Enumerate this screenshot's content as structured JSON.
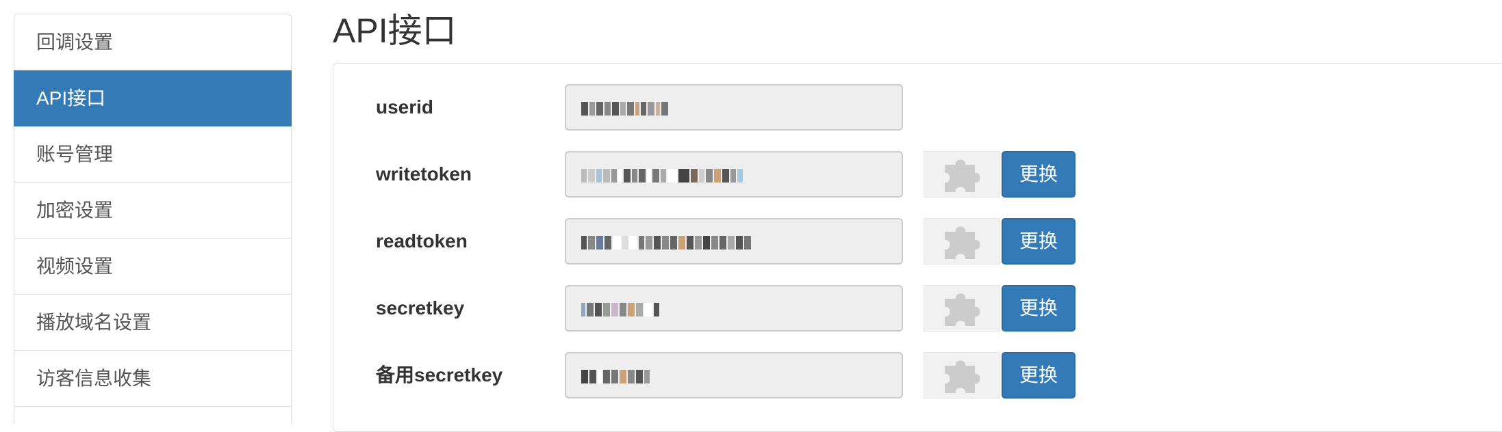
{
  "sidebar": {
    "items": [
      {
        "label": "回调设置",
        "active": false
      },
      {
        "label": "API接口",
        "active": true
      },
      {
        "label": "账号管理",
        "active": false
      },
      {
        "label": "加密设置",
        "active": false
      },
      {
        "label": "视频设置",
        "active": false
      },
      {
        "label": "播放域名设置",
        "active": false
      },
      {
        "label": "访客信息收集",
        "active": false
      }
    ]
  },
  "page": {
    "title": "API接口"
  },
  "fields": [
    {
      "label": "userid",
      "value_state": "masked",
      "has_change_button": false
    },
    {
      "label": "writetoken",
      "value_state": "masked",
      "has_change_button": true
    },
    {
      "label": "readtoken",
      "value_state": "masked",
      "has_change_button": true
    },
    {
      "label": "secretkey",
      "value_state": "masked",
      "has_change_button": true
    },
    {
      "label": "备用secretkey",
      "value_state": "masked",
      "has_change_button": true
    }
  ],
  "buttons": {
    "change_label": "更换"
  },
  "icons": {
    "plugin": "puzzle-piece-icon"
  },
  "colors": {
    "accent": "#337ab7",
    "input_bg": "#eeeeee",
    "border": "#dddddd",
    "icon_gray": "#cccccc"
  }
}
